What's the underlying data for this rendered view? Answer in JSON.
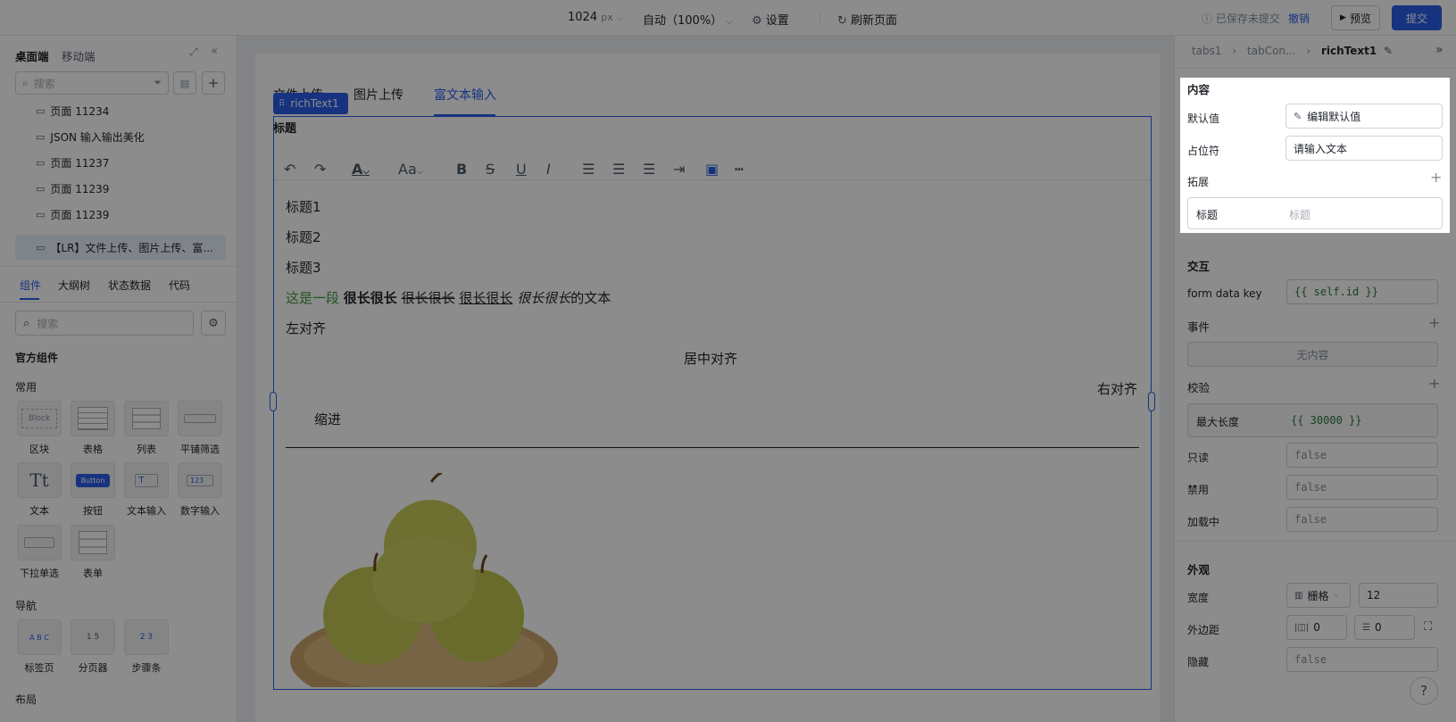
{
  "topbar": {
    "width_value": "1024",
    "width_unit": "px",
    "zoom": "自动（100%）",
    "settings": "设置",
    "refresh": "刷新页面",
    "saved_status": "已保存未提交",
    "undo": "撤销",
    "preview": "预览",
    "submit": "提交"
  },
  "left": {
    "tabs": [
      "桌面端",
      "移动端"
    ],
    "search_placeholder": "搜索",
    "pages": [
      "页面 11234",
      "JSON 输入输出美化",
      "页面 11237",
      "页面 11239",
      "页面 11239",
      "【LR】文件上传、图片上传、富..."
    ],
    "bottom_tabs": [
      "组件",
      "大纲树",
      "状态数据",
      "代码"
    ],
    "comp_search_placeholder": "搜索",
    "official": "官方组件",
    "groups": {
      "common": "常用",
      "nav": "导航",
      "layout": "布局"
    },
    "components": [
      {
        "label": "区块",
        "thumb": "Block"
      },
      {
        "label": "表格",
        "thumb": ""
      },
      {
        "label": "列表",
        "thumb": ""
      },
      {
        "label": "平铺筛选",
        "thumb": ""
      },
      {
        "label": "文本",
        "thumb": "Tt"
      },
      {
        "label": "按钮",
        "thumb": "Button"
      },
      {
        "label": "文本输入",
        "thumb": "T"
      },
      {
        "label": "数字输入",
        "thumb": "123"
      },
      {
        "label": "下拉单选",
        "thumb": ""
      },
      {
        "label": "表单",
        "thumb": ""
      }
    ],
    "nav_components": [
      {
        "label": "标签页",
        "thumb": "A B C"
      },
      {
        "label": "分页器",
        "thumb": "1 5"
      },
      {
        "label": "步骤条",
        "thumb": "2 3"
      }
    ]
  },
  "canvas": {
    "tabs": [
      "文件上传",
      "图片上传",
      "富文本输入"
    ],
    "selected_tag": "richText1",
    "field_title": "标题",
    "editor": {
      "h1": "标题1",
      "h2": "标题2",
      "h3": "标题3",
      "mixed": {
        "green": "这是一段",
        "bold": "很长很长",
        "strike": "很长很长",
        "underline": "很长很长",
        "italic": "很长很长",
        "tail": "的文本"
      },
      "left": "左对齐",
      "center": "居中对齐",
      "right": "右对齐",
      "indent": "缩进"
    }
  },
  "right": {
    "breadcrumb": [
      "tabs1",
      "tabCon...",
      "richText1"
    ],
    "content": {
      "title": "内容",
      "default_label": "默认值",
      "default_btn": "编辑默认值",
      "placeholder_label": "占位符",
      "placeholder_value": "请输入文本",
      "extend": "拓展",
      "ext_title_label": "标题",
      "ext_title_placeholder": "标题"
    },
    "interaction": {
      "title": "交互",
      "form_key_label": "form data key",
      "form_key_value": "{{ self.id }}",
      "events": "事件",
      "no_content": "无内容",
      "validation": "校验",
      "max_length_label": "最大长度",
      "max_length_value": "{{ 30000 }}",
      "readonly": "只读",
      "disabled": "禁用",
      "loading": "加载中",
      "false_value": "false"
    },
    "appearance": {
      "title": "外观",
      "width_label": "宽度",
      "width_mode": "栅格",
      "width_value": "12",
      "margin_label": "外边距",
      "margin_h": "0",
      "margin_v": "0",
      "hidden_label": "隐藏",
      "hidden_value": "false"
    }
  },
  "colors": {
    "primary": "#2b5ee8",
    "green_text": "#3f9a3a"
  }
}
